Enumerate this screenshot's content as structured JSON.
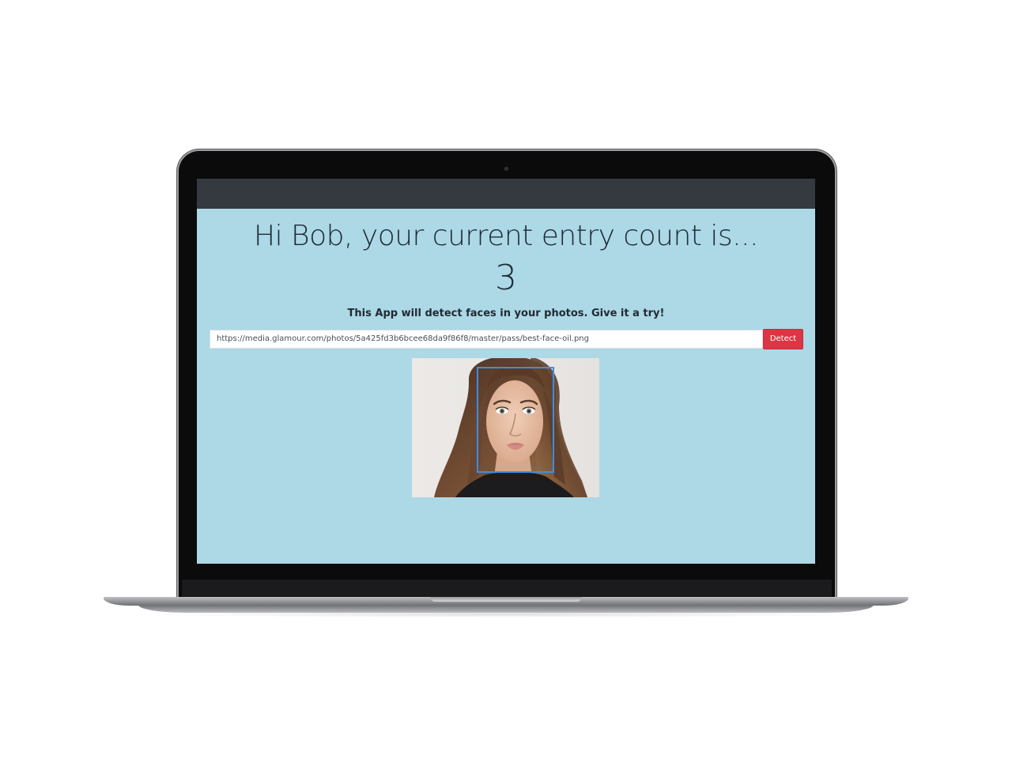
{
  "app": {
    "greeting": "Hi Bob, your current entry count is...",
    "entry_count": "3",
    "tagline": "This App will detect faces in your photos. Give it a try!"
  },
  "form": {
    "url_value": "https://media.glamour.com/photos/5a425fd3b6bcee68da9f86f8/master/pass/best-face-oil.png",
    "detect_label": "Detect"
  },
  "colors": {
    "background": "#add8e6",
    "navbar": "#343a40",
    "detect_button": "#dc3545",
    "face_box": "#3a8ee6"
  },
  "icons": {
    "camera": "webcam-dot"
  }
}
